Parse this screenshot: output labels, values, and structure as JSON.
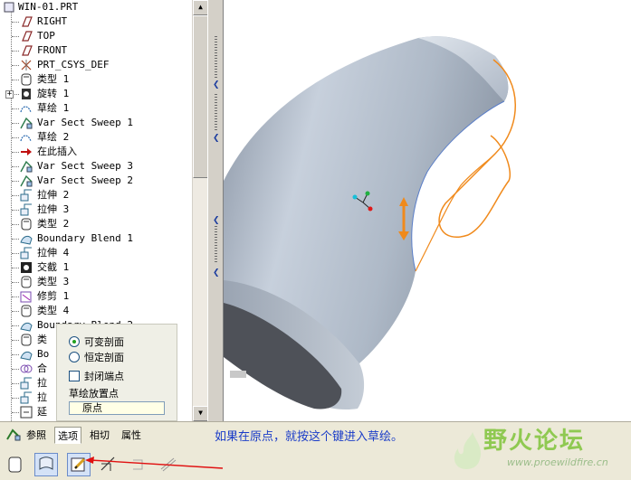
{
  "model_tree": {
    "items": [
      {
        "label": "WIN-01.PRT",
        "icon": "part-icon"
      },
      {
        "label": "RIGHT",
        "icon": "datum-plane-icon"
      },
      {
        "label": "TOP",
        "icon": "datum-plane-icon"
      },
      {
        "label": "FRONT",
        "icon": "datum-plane-icon"
      },
      {
        "label": "PRT_CSYS_DEF",
        "icon": "coordinate-system-icon"
      },
      {
        "label": "类型 1",
        "icon": "type-feature-icon"
      },
      {
        "label": "旋转 1",
        "icon": "revolve-icon"
      },
      {
        "label": "草绘 1",
        "icon": "sketch-icon"
      },
      {
        "label": "Var Sect Sweep 1",
        "icon": "sweep-icon"
      },
      {
        "label": "草绘 2",
        "icon": "sketch-icon"
      },
      {
        "label": "在此插入",
        "icon": "insert-here-arrow-icon"
      },
      {
        "label": "Var Sect Sweep 3",
        "icon": "sweep-icon"
      },
      {
        "label": "Var Sect Sweep 2",
        "icon": "sweep-icon"
      },
      {
        "label": "拉伸 2",
        "icon": "extrude-icon"
      },
      {
        "label": "拉伸 3",
        "icon": "extrude-icon"
      },
      {
        "label": "类型 2",
        "icon": "type-feature-icon"
      },
      {
        "label": "Boundary Blend 1",
        "icon": "boundary-blend-icon"
      },
      {
        "label": "拉伸 4",
        "icon": "extrude-icon"
      },
      {
        "label": "交截 1",
        "icon": "intersect-icon"
      },
      {
        "label": "类型 3",
        "icon": "type-feature-icon"
      },
      {
        "label": "修剪 1",
        "icon": "trim-icon"
      },
      {
        "label": "类型 4",
        "icon": "type-feature-icon"
      },
      {
        "label": "Boundary Blend 2",
        "icon": "boundary-blend-icon"
      },
      {
        "label": "类",
        "icon": "type-feature-icon"
      },
      {
        "label": "Bo",
        "icon": "boundary-blend-icon"
      },
      {
        "label": "合",
        "icon": "merge-icon"
      },
      {
        "label": "拉",
        "icon": "extrude-icon"
      },
      {
        "label": "拉",
        "icon": "extrude-icon"
      },
      {
        "label": "延",
        "icon": "extend-icon"
      }
    ]
  },
  "options_panel": {
    "variable_section": "可变剖面",
    "constant_section": "恒定剖面",
    "close_ends": "封闭端点",
    "sketch_placement_label": "草绘放置点",
    "sketch_placement_value": "原点"
  },
  "tabs": {
    "references": "参照",
    "options": "选项",
    "tangency": "相切",
    "properties": "属性"
  },
  "annotation": "如果在原点，就按这个键进入草绘。",
  "watermark": {
    "title": "野火论坛",
    "url": "www.proewildfire.cn"
  },
  "colors": {
    "annotation_blue": "#1a3cc8",
    "arrow_red": "#e01010",
    "trajectory_orange": "#f08a1c",
    "model_gray": "#b4bfcc"
  }
}
